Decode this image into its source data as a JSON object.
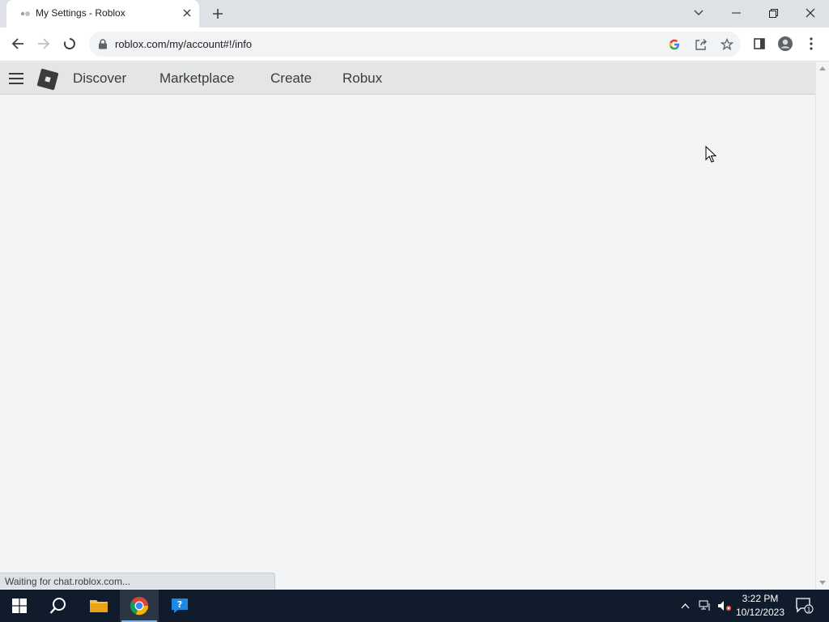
{
  "browser": {
    "tab": {
      "title": "My Settings - Roblox"
    },
    "url": "roblox.com/my/account#!/info",
    "status_text": "Waiting for chat.roblox.com..."
  },
  "roblox": {
    "nav": {
      "links": [
        "Discover",
        "Marketplace",
        "Create",
        "Robux"
      ]
    }
  },
  "taskbar": {
    "time": "3:22 PM",
    "date": "10/12/2023",
    "notification_count": "1"
  },
  "icons": {
    "favicon": "roblox-favicon",
    "tab_close": "close-icon",
    "new_tab": "plus-icon",
    "back": "back-arrow-icon",
    "forward": "forward-arrow-icon",
    "reload": "loading-spinner-icon",
    "lock": "lock-icon",
    "google": "google-icon",
    "share": "share-icon",
    "bookmark": "star-icon",
    "side_panel": "side-panel-icon",
    "profile": "profile-icon",
    "menu": "kebab-menu-icon",
    "hamburger": "hamburger-icon",
    "roblox_logo": "roblox-logo-icon"
  },
  "colors": {
    "tabstrip": "#dee1e6",
    "page_bg": "#f2f4f5",
    "roblox_header": "#e3e5e7",
    "taskbar": "#101c2b"
  }
}
